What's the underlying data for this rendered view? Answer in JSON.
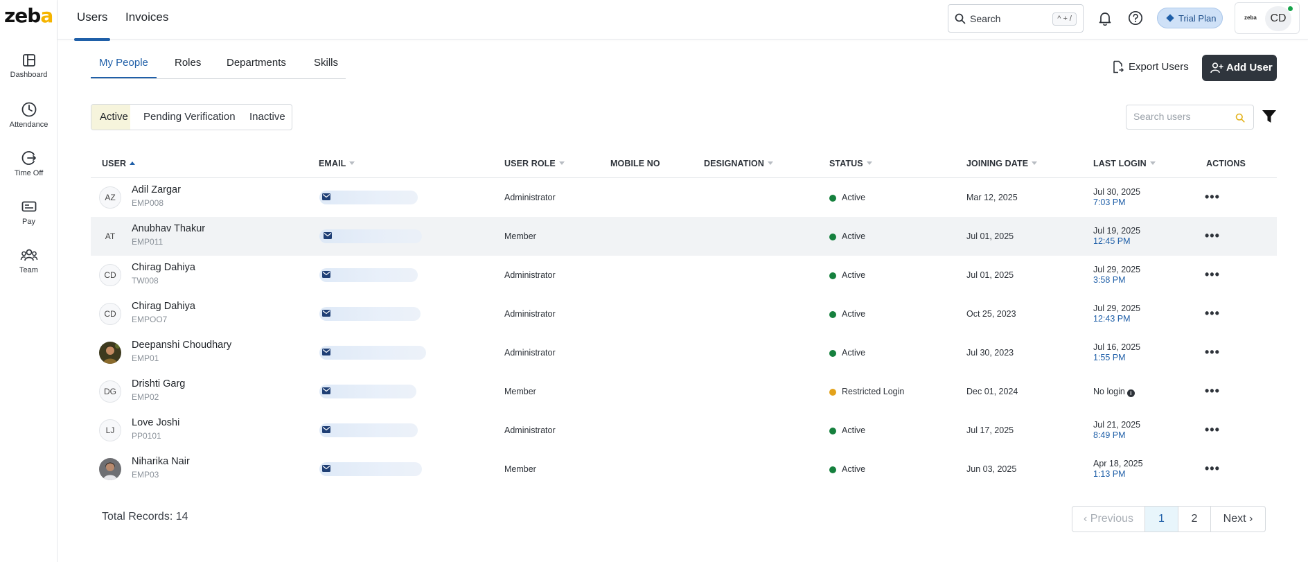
{
  "app": {
    "logo_text": "zeba"
  },
  "rail": [
    {
      "label": "Dashboard",
      "icon": "dashboard-icon"
    },
    {
      "label": "Attendance",
      "icon": "clock-icon"
    },
    {
      "label": "Time Off",
      "icon": "time-off-icon"
    },
    {
      "label": "Pay",
      "icon": "pay-icon"
    },
    {
      "label": "Team",
      "icon": "team-icon"
    }
  ],
  "topbar": {
    "tabs": [
      "Users",
      "Invoices"
    ],
    "active_tab": "Users",
    "search_placeholder": "Search",
    "search_shortcut": "^ + /",
    "trial_label": "Trial Plan",
    "account_logo": "zeba",
    "account_initials": "CD"
  },
  "subtabs": [
    "My People",
    "Roles",
    "Departments",
    "Skills"
  ],
  "actions": {
    "export_label": "Export Users",
    "add_label": "Add User"
  },
  "status_filter": {
    "options": [
      "Active",
      "Pending Verification",
      "Inactive"
    ],
    "selected": "Active"
  },
  "user_search": {
    "placeholder": "Search users"
  },
  "table": {
    "columns": [
      "USER",
      "EMAIL",
      "USER ROLE",
      "MOBILE NO",
      "DESIGNATION",
      "STATUS",
      "JOINING DATE",
      "LAST LOGIN",
      "ACTIONS"
    ],
    "sorted_by": "USER",
    "rows": [
      {
        "initials": "AZ",
        "name": "Adil Zargar",
        "id": "EMP008",
        "role": "Administrator",
        "status": "Active",
        "status_color": "#15803d",
        "joining": "Mar 12, 2025",
        "last_date": "Jul 30, 2025",
        "last_time": "7:03 PM"
      },
      {
        "initials": "AT",
        "name": "Anubhav Thakur",
        "id": "EMP011",
        "role": "Member",
        "status": "Active",
        "status_color": "#15803d",
        "joining": "Jul 01, 2025",
        "last_date": "Jul 19, 2025",
        "last_time": "12:45 PM"
      },
      {
        "initials": "CD",
        "name": "Chirag Dahiya",
        "id": "TW008",
        "role": "Administrator",
        "status": "Active",
        "status_color": "#15803d",
        "joining": "Jul 01, 2025",
        "last_date": "Jul 29, 2025",
        "last_time": "3:58 PM"
      },
      {
        "initials": "CD",
        "name": "Chirag Dahiya",
        "id": "EMPOO7",
        "role": "Administrator",
        "status": "Active",
        "status_color": "#15803d",
        "joining": "Oct 25, 2023",
        "last_date": "Jul 29, 2025",
        "last_time": "12:43 PM"
      },
      {
        "initials": "",
        "name": "Deepanshi Choudhary",
        "id": "EMP01",
        "role": "Administrator",
        "status": "Active",
        "status_color": "#15803d",
        "joining": "Jul 30, 2023",
        "last_date": "Jul 16, 2025",
        "last_time": "1:55 PM"
      },
      {
        "initials": "DG",
        "name": "Drishti Garg",
        "id": "EMP02",
        "role": "Member",
        "status": "Restricted Login",
        "status_color": "#e3a21a",
        "joining": "Dec 01, 2024",
        "last_date": "",
        "last_time": "",
        "no_login": "No login"
      },
      {
        "initials": "LJ",
        "name": "Love Joshi",
        "id": "PP0101",
        "role": "Administrator",
        "status": "Active",
        "status_color": "#15803d",
        "joining": "Jul 17, 2025",
        "last_date": "Jul 21, 2025",
        "last_time": "8:49 PM"
      },
      {
        "initials": "",
        "name": "Niharika Nair",
        "id": "EMP03",
        "role": "Member",
        "status": "Active",
        "status_color": "#15803d",
        "joining": "Jun 03, 2025",
        "last_date": "Apr 18, 2025",
        "last_time": "1:13 PM"
      }
    ]
  },
  "footer": {
    "total_label": "Total Records: 14",
    "pager": {
      "previous": "Previous",
      "pages": [
        "1",
        "2"
      ],
      "current": "1",
      "next": "Next"
    }
  },
  "colors": {
    "accent": "#1f5fa8",
    "primary_button": "#2f353d",
    "active_status": "#15803d",
    "restricted_status": "#e3a21a"
  }
}
